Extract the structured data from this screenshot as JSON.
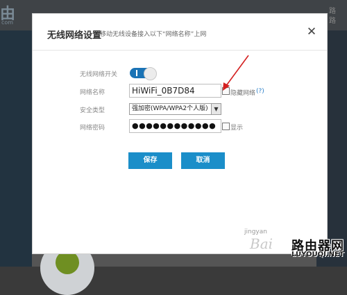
{
  "background": {
    "logo_text": "由",
    "logo_sub": "com",
    "right_text": "路\n路"
  },
  "dialog": {
    "title": "无线网络设置",
    "subtitle": "移动无线设备接入以下“网络名称”上网",
    "close_icon": "close-icon"
  },
  "form": {
    "wifi_switch_label": "无线网络开关",
    "wifi_switch_on": true,
    "ssid_label": "网络名称",
    "ssid_value": "HiWiFi_0B7D84",
    "hide_network_label": "隐藏网络",
    "help_text": "(?)",
    "security_label": "安全类型",
    "security_value": "强加密(WPA/WPA2个人版)",
    "password_label": "网络密码",
    "password_value": "●●●●●●●●●●●●",
    "show_label": "显示"
  },
  "buttons": {
    "save": "保存",
    "cancel": "取消"
  },
  "watermark": {
    "jingyan": "jingyan",
    "baidu": "Bai",
    "site_cn": "路由器网",
    "site_en": "LUYOUQI.NET"
  },
  "colors": {
    "accent": "#1b8ec9",
    "toggle_on": "#1a73b5",
    "arrow": "#d42020",
    "help_link": "#2a7fc8"
  }
}
